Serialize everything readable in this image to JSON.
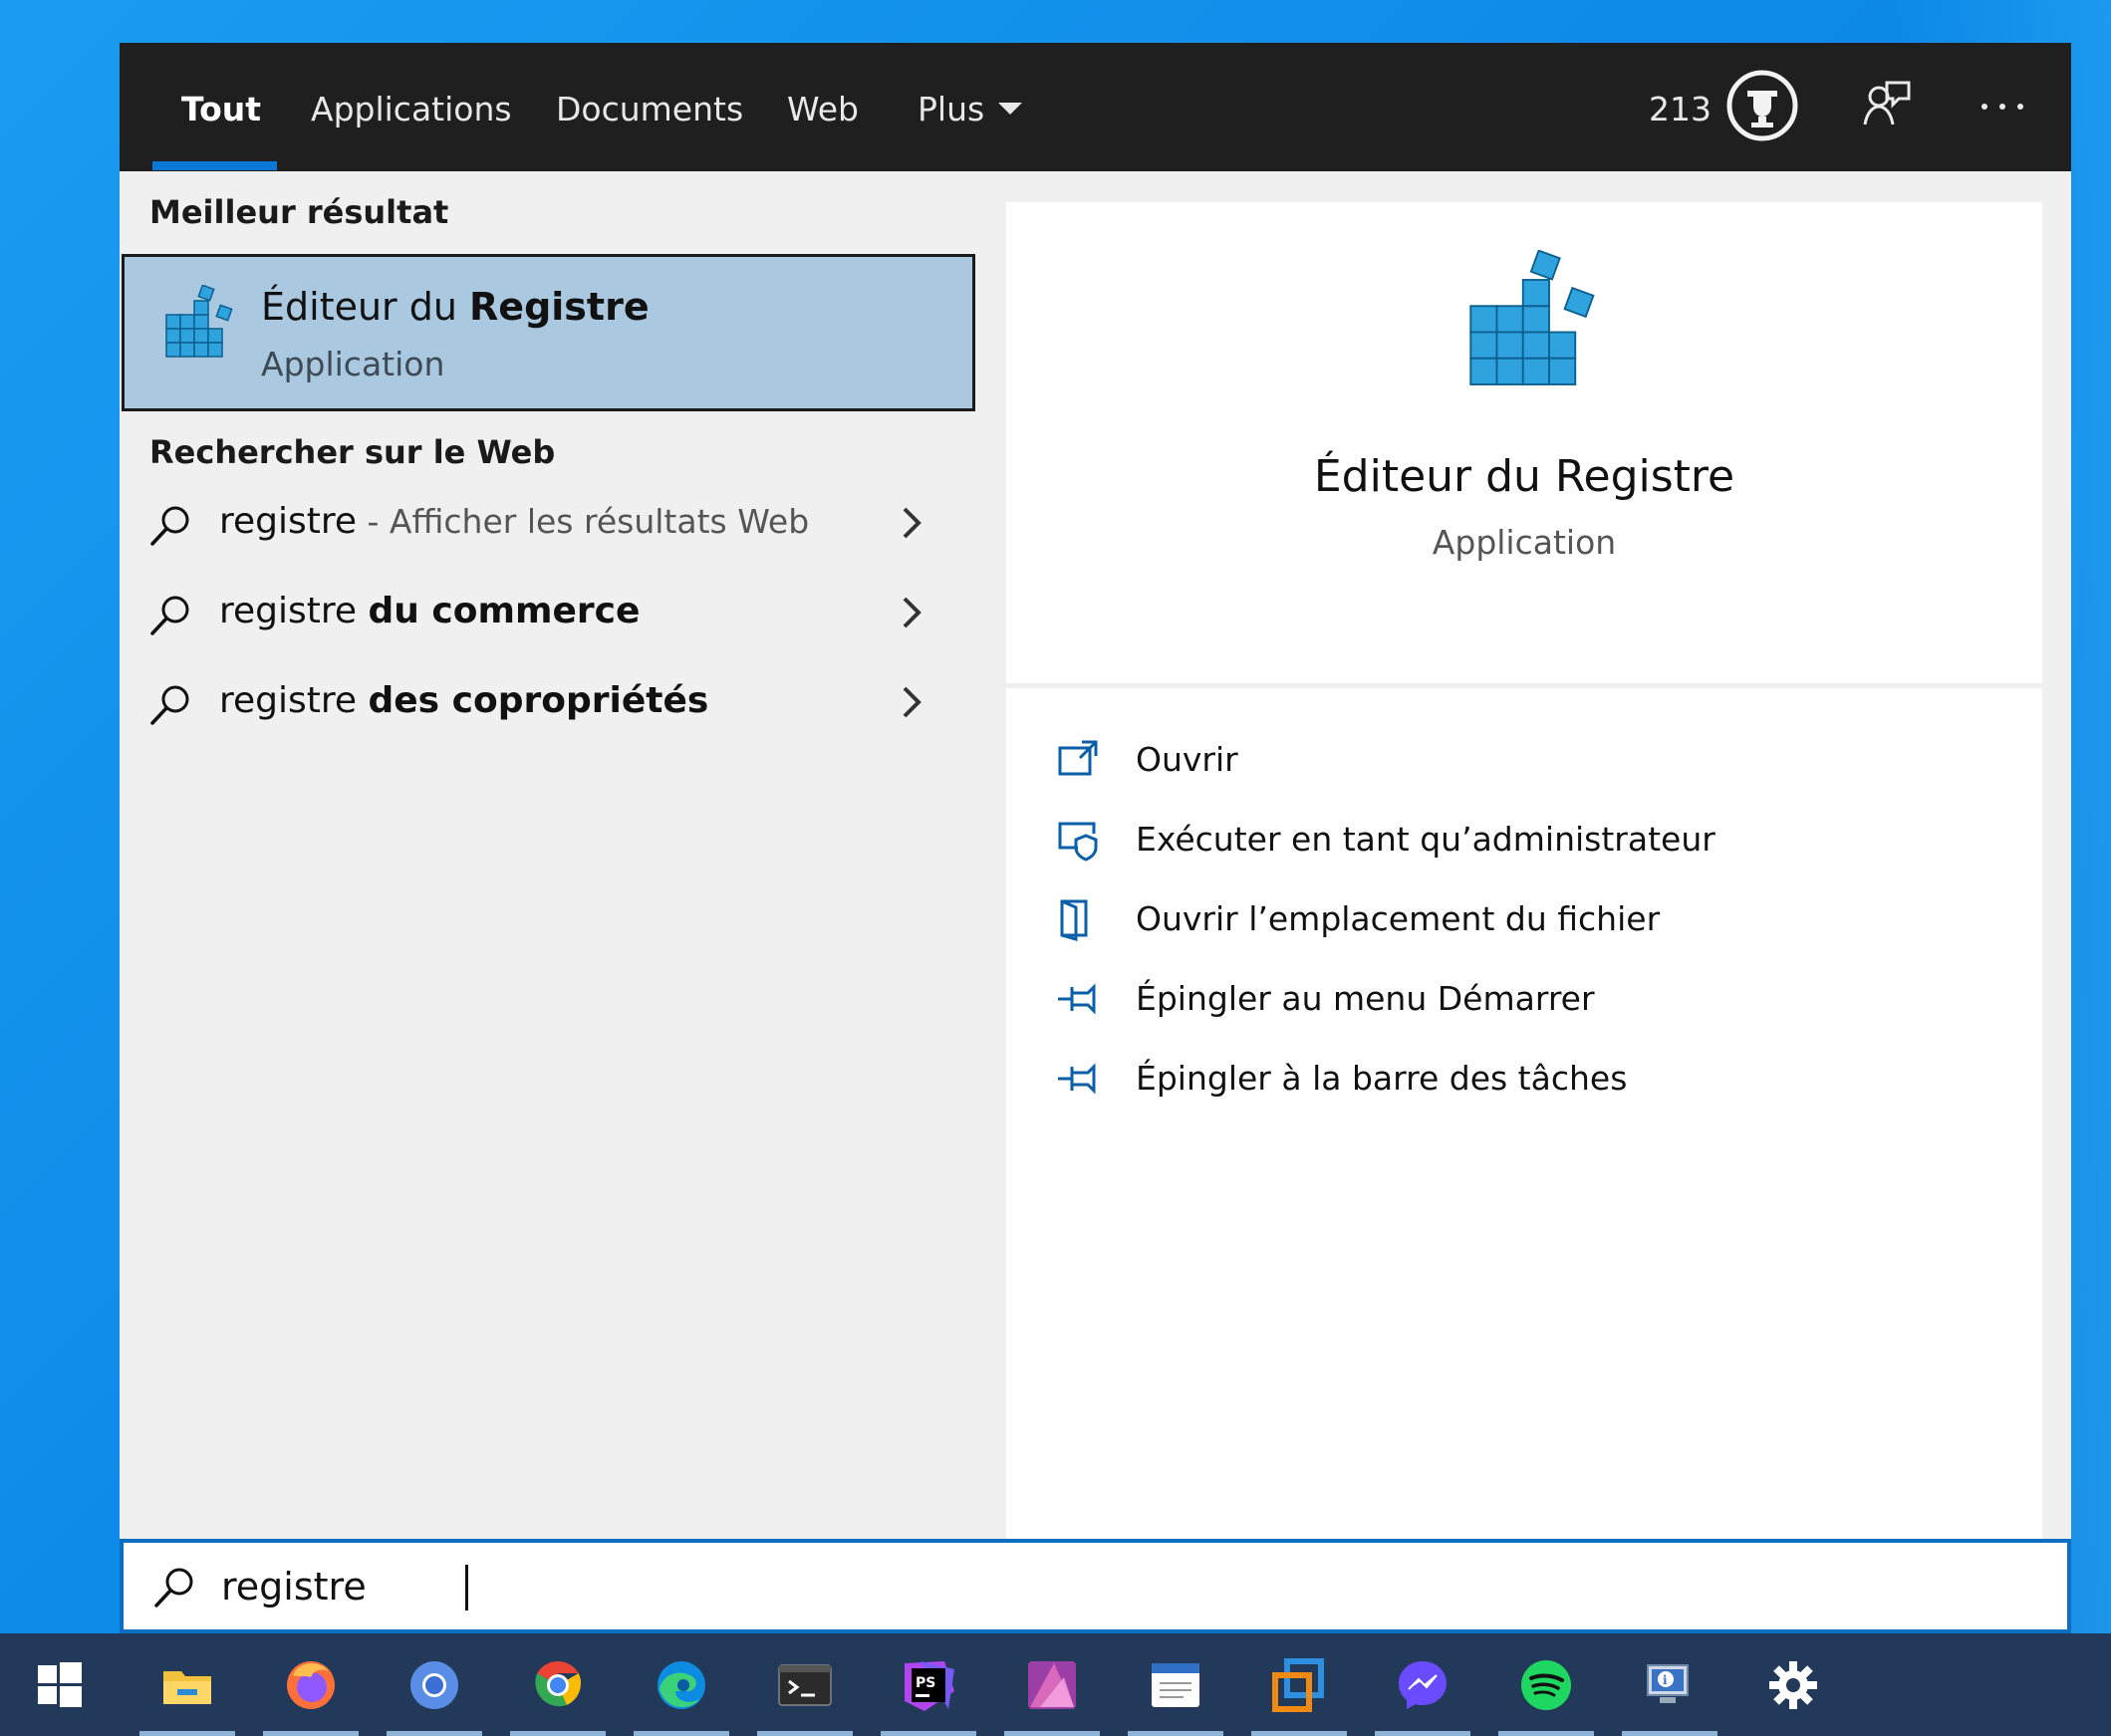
{
  "tabs": [
    {
      "label": "Tout",
      "active": true
    },
    {
      "label": "Applications"
    },
    {
      "label": "Documents"
    },
    {
      "label": "Web"
    },
    {
      "label": "Plus"
    }
  ],
  "rewards": {
    "points": "213"
  },
  "left": {
    "best_heading": "Meilleur résultat",
    "best": {
      "title_regular": "Éditeur du ",
      "title_bold": "Registre",
      "subtitle": "Application"
    },
    "web_heading": "Rechercher sur le Web",
    "web_results": [
      {
        "query": "registre",
        "bold": "",
        "suffix": " - Afficher les résultats Web"
      },
      {
        "query": "registre ",
        "bold": "du commerce",
        "suffix": ""
      },
      {
        "query": "registre ",
        "bold": "des copropriétés",
        "suffix": ""
      }
    ]
  },
  "detail": {
    "title": "Éditeur du Registre",
    "subtitle": "Application",
    "actions": [
      {
        "label": "Ouvrir",
        "icon": "open-icon"
      },
      {
        "label": "Exécuter en tant qu’administrateur",
        "icon": "run-as-admin-icon"
      },
      {
        "label": "Ouvrir l’emplacement du fichier",
        "icon": "file-location-icon"
      },
      {
        "label": "Épingler au menu Démarrer",
        "icon": "pin-icon"
      },
      {
        "label": "Épingler à la barre des tâches",
        "icon": "pin-icon"
      }
    ]
  },
  "search": {
    "value": "registre"
  },
  "taskbar": {
    "items": [
      "windows-start-icon",
      "file-explorer-icon",
      "firefox-icon",
      "chromium-icon",
      "chrome-icon",
      "edge-icon",
      "terminal-icon",
      "phpstorm-icon",
      "affinity-photo-icon",
      "notepad-icon",
      "virtualbox-icon",
      "messenger-icon",
      "spotify-icon",
      "system-info-icon",
      "settings-icon"
    ]
  },
  "colors": {
    "accent": "#0a78d7",
    "selection": "#aac8e0",
    "topbar": "#1f1f1f",
    "taskbar": "#22395a"
  }
}
